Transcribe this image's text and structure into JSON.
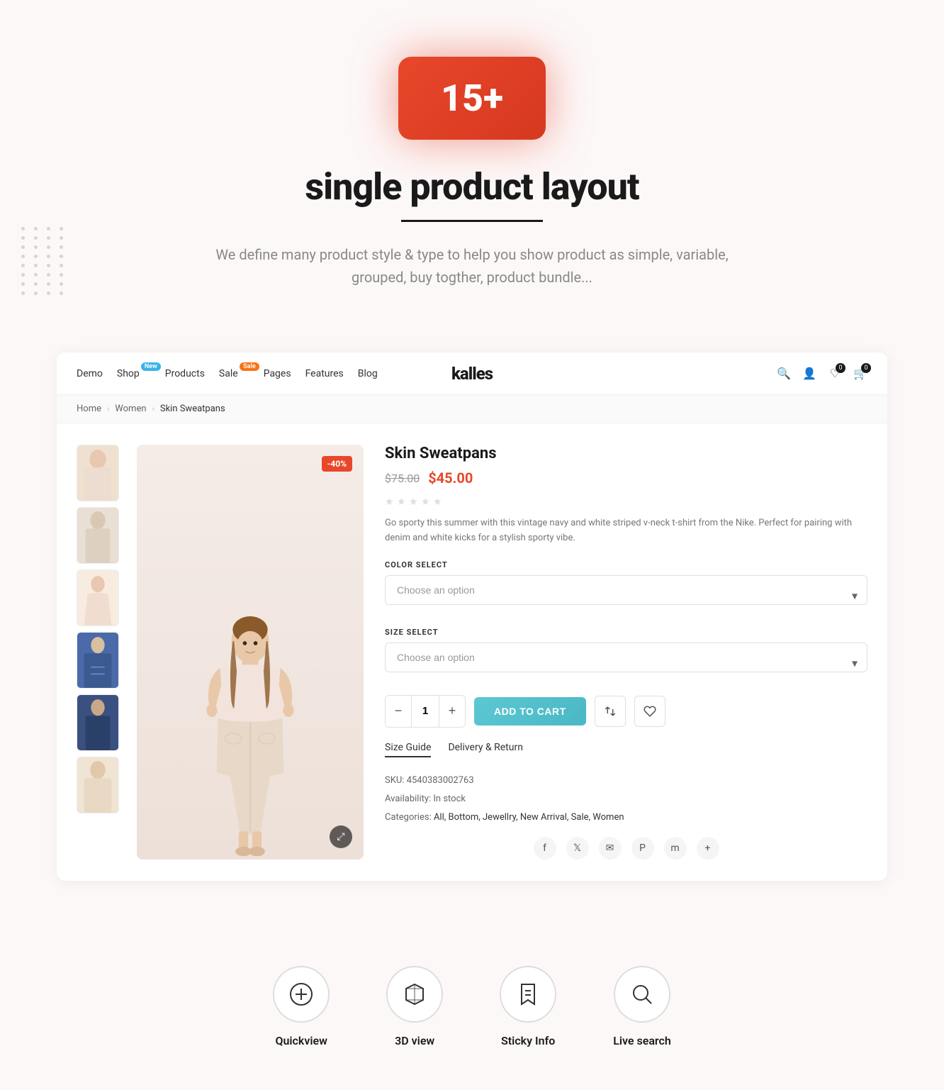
{
  "hero": {
    "badge": "15+",
    "title": "single product layout",
    "description": "We define many product style & type to help you show product as simple, variable, grouped, buy togther, product bundle..."
  },
  "navbar": {
    "logo": "kalles",
    "items": [
      {
        "label": "Demo",
        "badge": null
      },
      {
        "label": "Shop",
        "badge": "New"
      },
      {
        "label": "Products",
        "badge": null
      },
      {
        "label": "Sale",
        "badge": "Sale"
      },
      {
        "label": "Pages",
        "badge": null
      },
      {
        "label": "Features",
        "badge": null
      },
      {
        "label": "Blog",
        "badge": null
      }
    ],
    "wishlist_count": "0",
    "cart_count": "0"
  },
  "breadcrumb": {
    "items": [
      "Home",
      "Women",
      "Skin Sweatpans"
    ]
  },
  "product": {
    "name": "Skin Sweatpans",
    "old_price": "$75.00",
    "new_price": "$45.00",
    "discount": "-40%",
    "description": "Go sporty this summer with this vintage navy and white striped v-neck t-shirt from the Nike. Perfect for pairing with denim and white kicks for a stylish sporty vibe.",
    "color_label": "COLOR SELECT",
    "color_placeholder": "Choose an option",
    "size_label": "SIZE SELECT",
    "size_placeholder": "Choose an option",
    "quantity": "1",
    "add_to_cart": "ADD TO CART",
    "tabs": [
      "Size Guide",
      "Delivery & Return"
    ],
    "sku": "SKU: 4540383002763",
    "availability": "Availability: In stock",
    "categories_label": "Categories:",
    "categories": "All, Bottom, Jewellry, New Arrival, Sale, Women"
  },
  "features": [
    {
      "icon": "plus-circle",
      "label": "Quickview",
      "symbol": "⊕"
    },
    {
      "icon": "box-3d",
      "label": "3D view",
      "symbol": "⬡"
    },
    {
      "icon": "bookmark",
      "label": "Sticky Info",
      "symbol": "🔖"
    },
    {
      "icon": "search",
      "label": "Live search",
      "symbol": "🔍"
    }
  ],
  "colors": {
    "accent_red": "#e8472a",
    "accent_teal": "#5bc8d4",
    "badge_new": "#3bb3e8",
    "badge_sale": "#f97316"
  }
}
